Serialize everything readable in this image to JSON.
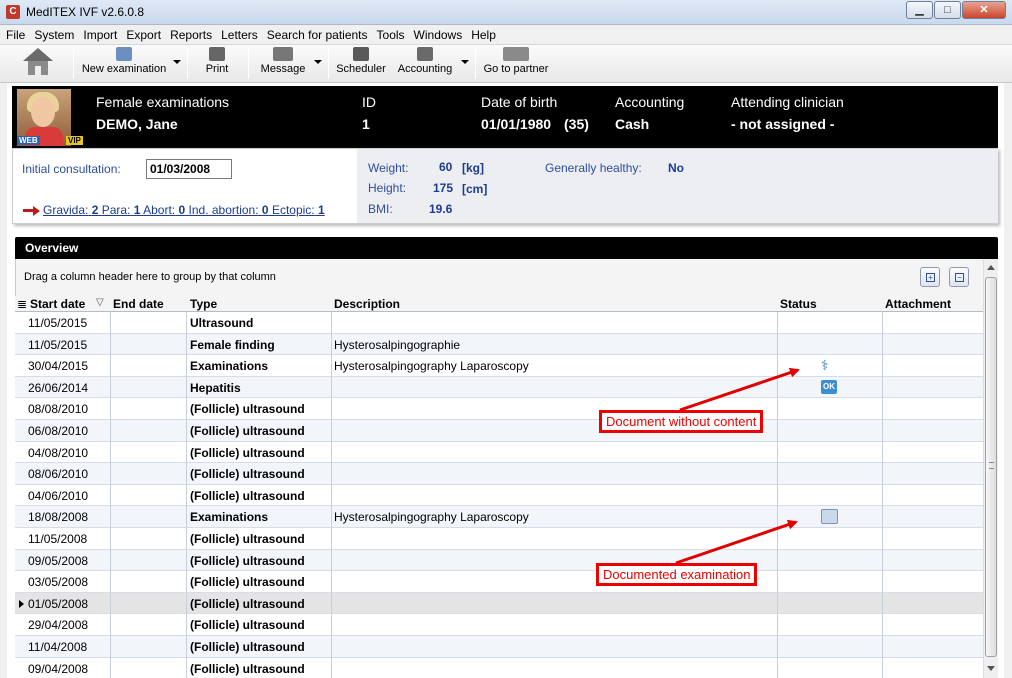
{
  "window": {
    "title": "MedITEX IVF v2.6.0.8",
    "icon_letter": "C"
  },
  "menu": [
    "File",
    "System",
    "Import",
    "Export",
    "Reports",
    "Letters",
    "Search for patients",
    "Tools",
    "Windows",
    "Help"
  ],
  "toolbar": {
    "new_examination": "New examination",
    "print": "Print",
    "message": "Message",
    "scheduler": "Scheduler",
    "accounting": "Accounting",
    "go_to_partner": "Go to partner"
  },
  "patient": {
    "type_label": "Female examinations",
    "name": "DEMO, Jane",
    "id_label": "ID",
    "id": "1",
    "dob_label": "Date of birth",
    "dob": "01/01/1980",
    "age": "(35)",
    "accounting_label": "Accounting",
    "accounting": "Cash",
    "clinician_label": "Attending clinician",
    "clinician": "- not assigned -",
    "badge_web": "WEB",
    "badge_vip": "VIP"
  },
  "info": {
    "initial_consultation_label": "Initial consultation:",
    "initial_consultation": "01/03/2008",
    "weight_label": "Weight:",
    "weight": "60",
    "weight_unit": "[kg]",
    "height_label": "Height:",
    "height": "175",
    "height_unit": "[cm]",
    "bmi_label": "BMI:",
    "bmi": "19.6",
    "healthy_label": "Generally healthy:",
    "healthy": "No",
    "gravida_label": "Gravida:",
    "gravida": "2",
    "para_label": "Para:",
    "para": "1",
    "abort_label": "Abort:",
    "abort": "0",
    "ind_abortion_label": "Ind. abortion:",
    "ind_abortion": "0",
    "ectopic_label": "Ectopic:",
    "ectopic": "1"
  },
  "overview": {
    "title": "Overview",
    "group_hint": "Drag a column header here to group by that column",
    "expand_symbol": "+",
    "collapse_symbol": "−",
    "columns": {
      "start_date": "Start date",
      "end_date": "End date",
      "type": "Type",
      "description": "Description",
      "status": "Status",
      "attachment": "Attachment"
    },
    "rows": [
      {
        "start": "11/05/2015",
        "type": "Ultrasound",
        "description": "",
        "status": ""
      },
      {
        "start": "11/05/2015",
        "type": "Female finding",
        "description": "Hysterosalpingographie",
        "status": ""
      },
      {
        "start": "30/04/2015",
        "type": "Examinations",
        "description": "Hysterosalpingography  Laparoscopy",
        "status": "stethoscope-icon"
      },
      {
        "start": "26/06/2014",
        "type": "Hepatitis",
        "description": "",
        "status": "ok-icon"
      },
      {
        "start": "08/08/2010",
        "type": "(Follicle) ultrasound",
        "description": "",
        "status": ""
      },
      {
        "start": "06/08/2010",
        "type": "(Follicle) ultrasound",
        "description": "",
        "status": ""
      },
      {
        "start": "04/08/2010",
        "type": "(Follicle) ultrasound",
        "description": "",
        "status": ""
      },
      {
        "start": "08/06/2010",
        "type": "(Follicle) ultrasound",
        "description": "",
        "status": ""
      },
      {
        "start": "04/06/2010",
        "type": "(Follicle) ultrasound",
        "description": "",
        "status": ""
      },
      {
        "start": "18/08/2008",
        "type": "Examinations",
        "description": "Hysterosalpingography  Laparoscopy",
        "status": "documented-stethoscope-icon"
      },
      {
        "start": "11/05/2008",
        "type": "(Follicle) ultrasound",
        "description": "",
        "status": ""
      },
      {
        "start": "09/05/2008",
        "type": "(Follicle) ultrasound",
        "description": "",
        "status": ""
      },
      {
        "start": "03/05/2008",
        "type": "(Follicle) ultrasound",
        "description": "",
        "status": ""
      },
      {
        "start": "01/05/2008",
        "type": "(Follicle) ultrasound",
        "description": "",
        "status": "",
        "selected": true
      },
      {
        "start": "29/04/2008",
        "type": "(Follicle) ultrasound",
        "description": "",
        "status": ""
      },
      {
        "start": "11/04/2008",
        "type": "(Follicle) ultrasound",
        "description": "",
        "status": ""
      },
      {
        "start": "09/04/2008",
        "type": "(Follicle) ultrasound",
        "description": "",
        "status": ""
      }
    ],
    "ok_text": "OK"
  },
  "annotations": {
    "doc_without_content": "Document without content",
    "documented_examination": "Documented examination",
    "color": "#e00000"
  }
}
